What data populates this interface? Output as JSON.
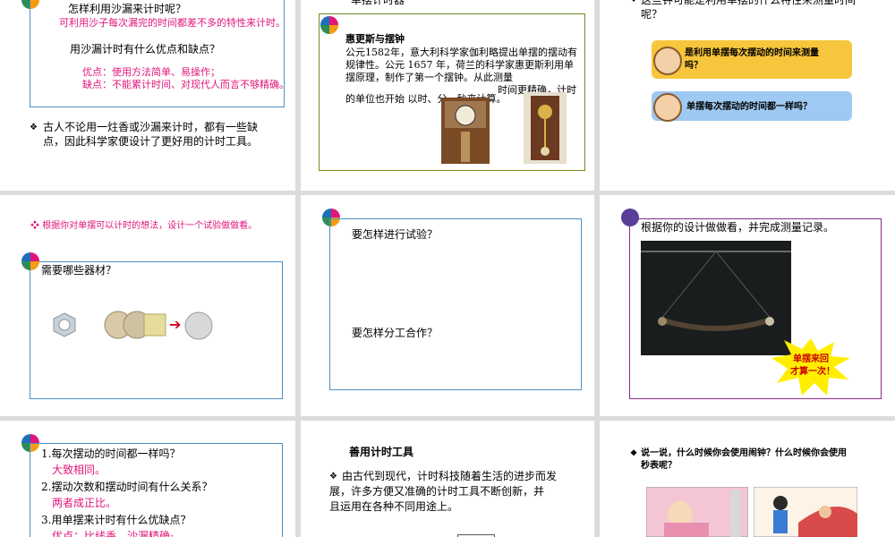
{
  "slide1": {
    "title": "怎样利用沙漏来计时呢？",
    "subtitle": "可利用沙子每次漏完的时间都差不多的特性来计时。",
    "question": "用沙漏计时有什么优点和缺点？",
    "pros": "优点：使用方法简单、易操作；",
    "cons": "缺点：不能累计时间、对现代人而言不够精确。",
    "bullet1": "古人不论用一炷香或沙漏来计时，都有一些缺",
    "bullet2": "点，因此科学家便设计了更好用的计时工具。"
  },
  "slide2": {
    "heading": "单摆计时器",
    "box_title": "惠更斯与摆钟",
    "p1": "公元1582年，意大利科学家伽利略提出单摆的摆动有",
    "p2": "规律性。公元  1657  年，荷兰的科学家惠更斯利用单",
    "p3": "摆原理，制作了第一个摆钟。从此测量",
    "p4": "时间更精确，计时",
    "p5": "的单位也开始  以时、分、秒来计算。"
  },
  "slide3": {
    "question1": "这些钟可能是利用单摆的什么特性来测量时间",
    "question2": "呢？",
    "bubble1_line1": "是利用单摆每次摆动的时间来测量",
    "bubble1_line2": "吗？",
    "bubble2": "单摆每次摆动的时间都一样吗？"
  },
  "slide4": {
    "instruction": "根据你对单摆可以计时的想法，设计一个试验做做看。",
    "materials": "需要哪些器材？"
  },
  "slide5": {
    "q1": "要怎样进行试验？",
    "q2": "要怎样分工合作？"
  },
  "slide6": {
    "instruction": "根据你的设计做做看，并完成测量记录。",
    "burst_line1": "单摆来回",
    "burst_line2": "才算一次！"
  },
  "slide7": {
    "q1": "1.每次摆动的时间都一样吗？",
    "a1": "大致相同。",
    "q2": "2.摆动次数和摆动时间有什么关系？",
    "a2": "两者成正比。",
    "q3": "3.用单摆来计时有什么优缺点？",
    "a3": "优点：比线香、沙漏精确;"
  },
  "slide8": {
    "title": "善用计时工具",
    "b1": "由古代到现代，计时科技随着生活的进步而发",
    "b2": "展，许多方便又准确的计时工具不断创新，并",
    "b3": "且运用在各种不同用途上。"
  },
  "slide9": {
    "b1": "说一说，什么时候你会使用闹钟？什么时候你会使用",
    "b2": "秒表呢？"
  },
  "colors": {
    "pink": "#e0157a",
    "blue_border": "#4a90c8",
    "green_border": "#6b8e23",
    "purple_border": "#8b2a8b",
    "bubble": "#f7c63c"
  }
}
